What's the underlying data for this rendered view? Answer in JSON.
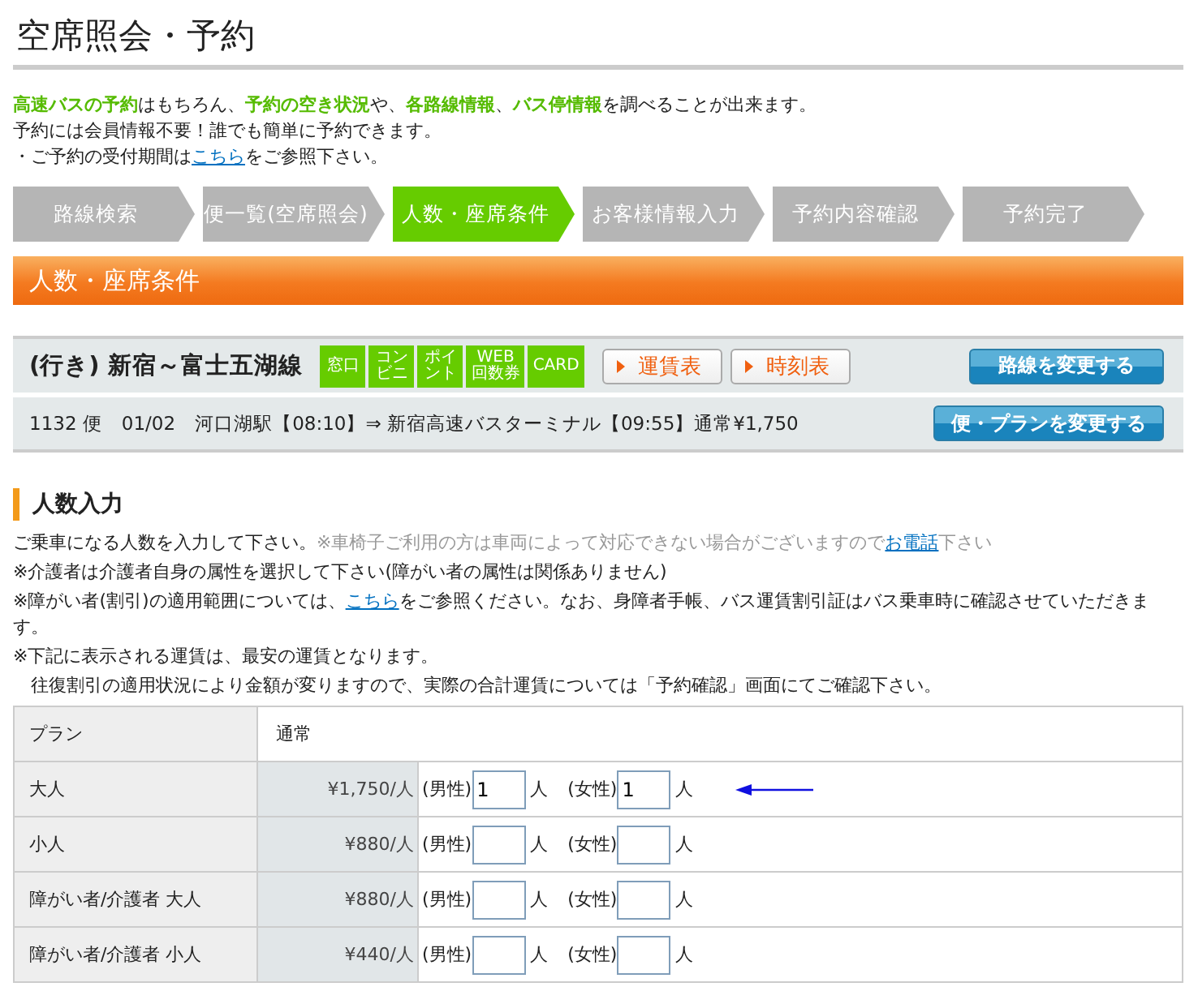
{
  "page_title": "空席照会・予約",
  "intro": [
    {
      "parts": [
        {
          "kind": "text",
          "text": "**高速バスの予約**はもちろん、**予約の空き状況**や、**各路線情報**、**バス停情報**を調べることが出来ます。"
        }
      ]
    },
    {
      "parts": [
        {
          "kind": "text",
          "text": "予約には会員情報不要！誰でも簡単に予約できます。"
        }
      ]
    },
    {
      "parts": [
        {
          "kind": "text",
          "text": "・ご予約の受付期間は"
        },
        {
          "kind": "link",
          "text": "こちら"
        },
        {
          "kind": "text",
          "text": "をご参照下さい。"
        }
      ]
    }
  ],
  "steps": [
    {
      "label": "路線検索",
      "selected": false
    },
    {
      "label": "便一覧(空席照会)",
      "selected": false
    },
    {
      "label": "人数・座席条件",
      "selected": true
    },
    {
      "label": "お客様情報入力",
      "selected": false
    },
    {
      "label": "予約内容確認",
      "selected": false
    },
    {
      "label": "予約完了",
      "selected": false
    }
  ],
  "section_banner": "人数・座席条件",
  "route": {
    "title": "(行き) 新宿～富士五湖線",
    "badges": [
      {
        "lines": [
          "窓口"
        ]
      },
      {
        "lines": [
          "コン",
          "ビニ"
        ]
      },
      {
        "lines": [
          "ポイ",
          "ント"
        ]
      },
      {
        "lines": [
          "WEB",
          "回数券"
        ]
      },
      {
        "lines": [
          "CARD"
        ]
      }
    ],
    "links": [
      "運賃表",
      "時刻表"
    ],
    "change_button": "路線を変更する"
  },
  "trip": {
    "text": "1132 便　01/02　河口湖駅【08:10】⇒ 新宿高速バスターミナル【09:55】通常¥1,750",
    "change_button": "便・プランを変更する"
  },
  "heading": "人数入力",
  "notes": [
    {
      "parts": [
        {
          "kind": "text",
          "text": "ご乗車になる人数を入力して下さい。"
        },
        {
          "kind": "muted",
          "text": "※車椅子ご利用の方は車両によって対応できない場合がございますので"
        },
        {
          "kind": "link",
          "text": "お電話"
        },
        {
          "kind": "muted",
          "text": "下さい"
        }
      ]
    },
    {
      "parts": [
        {
          "kind": "text",
          "text": "※介護者は介護者自身の属性を選択して下さい(障がい者の属性は関係ありません)"
        }
      ]
    },
    {
      "parts": [
        {
          "kind": "text",
          "text": "※障がい者(割引)の適用範囲については、"
        },
        {
          "kind": "link",
          "text": "こちら"
        },
        {
          "kind": "text",
          "text": "をご参照ください。なお、身障者手帳、バス運賃割引証はバス乗車時に確認させていただきます。"
        }
      ]
    },
    {
      "parts": [
        {
          "kind": "text",
          "text": "※下記に表示される運賃は、最安の運賃となります。"
        }
      ]
    },
    {
      "parts": [
        {
          "kind": "text",
          "text": "　往復割引の適用状況により金額が変りますので、実際の合計運賃については「予約確認」画面にてご確認下さい。"
        }
      ]
    }
  ],
  "table": {
    "rows": [
      {
        "kind": "plan",
        "label": "プラン",
        "value": "通常"
      },
      {
        "kind": "fare",
        "label": "大人",
        "price": "¥1,750/人",
        "male_label": "(男性)",
        "male": "1",
        "male_unit": "人",
        "female_label": "(女性)",
        "female": "1",
        "female_unit": "人",
        "arrow": true
      },
      {
        "kind": "fare",
        "label": "小人",
        "price": "¥880/人",
        "male_label": "(男性)",
        "male_unit": "人",
        "female_label": "(女性)",
        "female_unit": "人",
        "arrow": false
      },
      {
        "kind": "fare",
        "label": "障がい者/介護者 大人",
        "price": "¥880/人",
        "male_label": "(男性)",
        "male_unit": "人",
        "female_label": "(女性)",
        "female_unit": "人",
        "arrow": false
      },
      {
        "kind": "fare",
        "label": "障がい者/介護者 小人",
        "price": "¥440/人",
        "male_label": "(男性)",
        "male_unit": "人",
        "female_label": "(女性)",
        "female_unit": "人",
        "arrow": false
      }
    ]
  }
}
